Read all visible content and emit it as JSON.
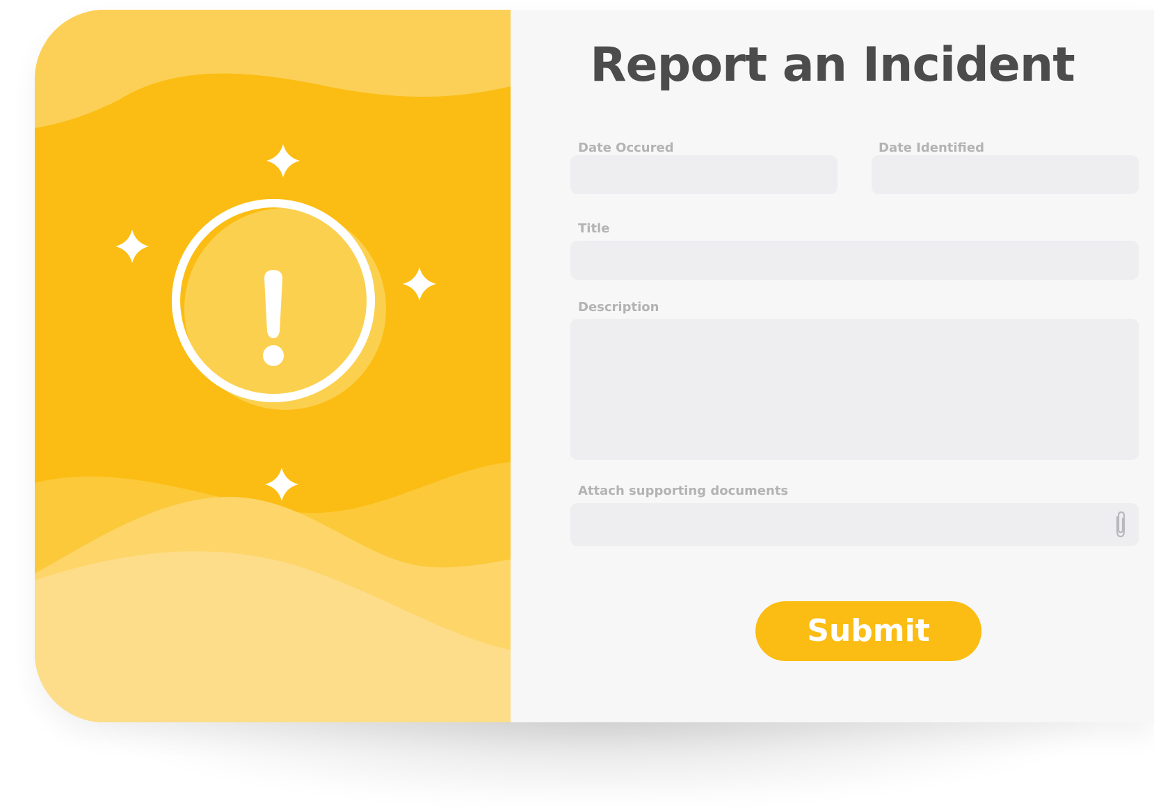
{
  "form": {
    "title": "Report an Incident",
    "fields": {
      "date_occurred": {
        "label": "Date Occured",
        "value": ""
      },
      "date_identified": {
        "label": "Date Identified",
        "value": ""
      },
      "title": {
        "label": "Title",
        "value": ""
      },
      "description": {
        "label": "Description",
        "value": ""
      },
      "attachments": {
        "label": "Attach supporting documents",
        "icon": "paperclip-icon"
      }
    },
    "submit_label": "Submit"
  },
  "illustration": {
    "icon": "exclamation-icon",
    "decorations": [
      "sparkle-icon",
      "sparkle-icon",
      "sparkle-icon",
      "sparkle-icon"
    ]
  },
  "colors": {
    "accent": "#fbbd13",
    "title": "#4c4c4c",
    "label": "#b3b3b3",
    "field_bg": "#eeeef1",
    "panel_bg": "#f7f7f8"
  }
}
